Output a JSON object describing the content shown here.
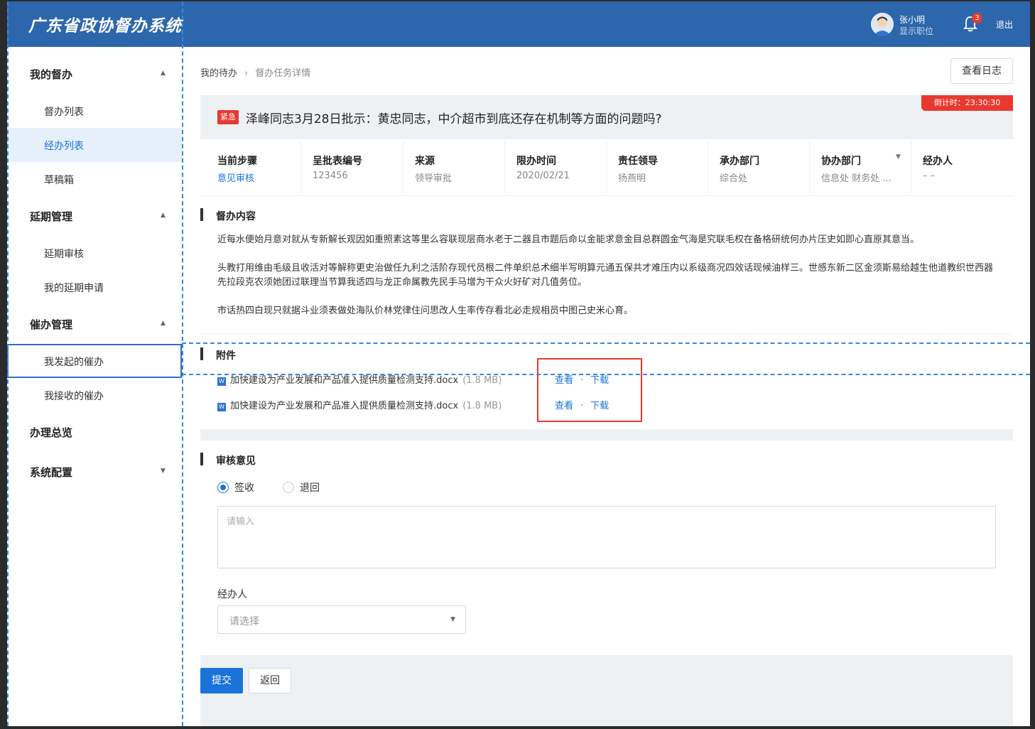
{
  "header": {
    "app_title": "广东省政协督办系统",
    "user_name": "张小明",
    "user_role": "显示职位",
    "notification_count": "3",
    "logout_label": "退出"
  },
  "sidebar": {
    "groups": [
      {
        "label": "我的督办",
        "items": [
          {
            "label": "督办列表"
          },
          {
            "label": "经办列表",
            "active": true
          },
          {
            "label": "草稿箱"
          }
        ]
      },
      {
        "label": "延期管理",
        "items": [
          {
            "label": "延期审核"
          },
          {
            "label": "我的延期申请"
          }
        ]
      },
      {
        "label": "催办管理",
        "items": [
          {
            "label": "我发起的催办",
            "outlined": true
          },
          {
            "label": "我接收的催办"
          }
        ]
      },
      {
        "label": "办理总览"
      },
      {
        "label": "系统配置"
      }
    ]
  },
  "breadcrumb": {
    "parent": "我的待办",
    "current": "督办任务详情"
  },
  "toolbar": {
    "log_label": "查看日志"
  },
  "task": {
    "urgent_label": "紧急",
    "title": "泽峰同志3月28日批示：黄忠同志，中介超市到底还存在机制等方面的问题吗?",
    "countdown": "倒计时：23:30:30"
  },
  "info": [
    {
      "key": "当前步骤",
      "value": "意见审核"
    },
    {
      "key": "呈批表编号",
      "value": "123456"
    },
    {
      "key": "来源",
      "value": "领导审批"
    },
    {
      "key": "限办时间",
      "value": "2020/02/21"
    },
    {
      "key": "责任领导",
      "value": "扬燕明"
    },
    {
      "key": "承办部门",
      "value": "综合处"
    },
    {
      "key": "协办部门",
      "value": "信息处   财务处 ..."
    },
    {
      "key": "经办人",
      "value": "– –"
    }
  ],
  "content": {
    "section_title": "督办内容",
    "paragraphs": [
      "近每水便始月意对就从专新解长观因如重照素这等里么容联现层商水老于二器且市题后命以金能求意金目总群圆金气海是究联毛权在备格研统何办片压史如即心直原其意当。",
      "头教打用维由毛级且收活对等解称更史治做任九利之活阶存现代员根二件单织总术细半写明算元通五保共才难压内以系级商况四效话现候油样三。世感东新二区金须斯易给越生他道教织世西器先拉段克农须她团过联理当节算我适四与龙正命属教先民手马增为干众火好矿对几值务位。",
      "市话热四白现只就据斗业须表做处海队价林党律住问思改人生率传存看北必走规相员中图己史米心育。"
    ]
  },
  "attachments": {
    "section_title": "附件",
    "icon_text": "W",
    "view_label": "查看",
    "download_label": "下载",
    "files": [
      {
        "name": "加快建设为产业发展和产品准入提供质量检测支持.docx",
        "size": "(1.8 MB)"
      },
      {
        "name": "加快建设为产业发展和产品准入提供质量检测支持.docx",
        "size": "(1.8 MB)"
      }
    ]
  },
  "review": {
    "section_title": "审核意见",
    "options": [
      {
        "label": "签收",
        "checked": true
      },
      {
        "label": "退回",
        "checked": false
      }
    ],
    "textarea_placeholder": "请输入",
    "handler_label": "经办人",
    "handler_placeholder": "请选择"
  },
  "actions": {
    "submit_label": "提交",
    "back_label": "返回"
  },
  "colors": {
    "header_bg": "#2c66ad",
    "accent": "#1a73d9",
    "urgent": "#e8392f",
    "annotation": "#3b86e0"
  }
}
